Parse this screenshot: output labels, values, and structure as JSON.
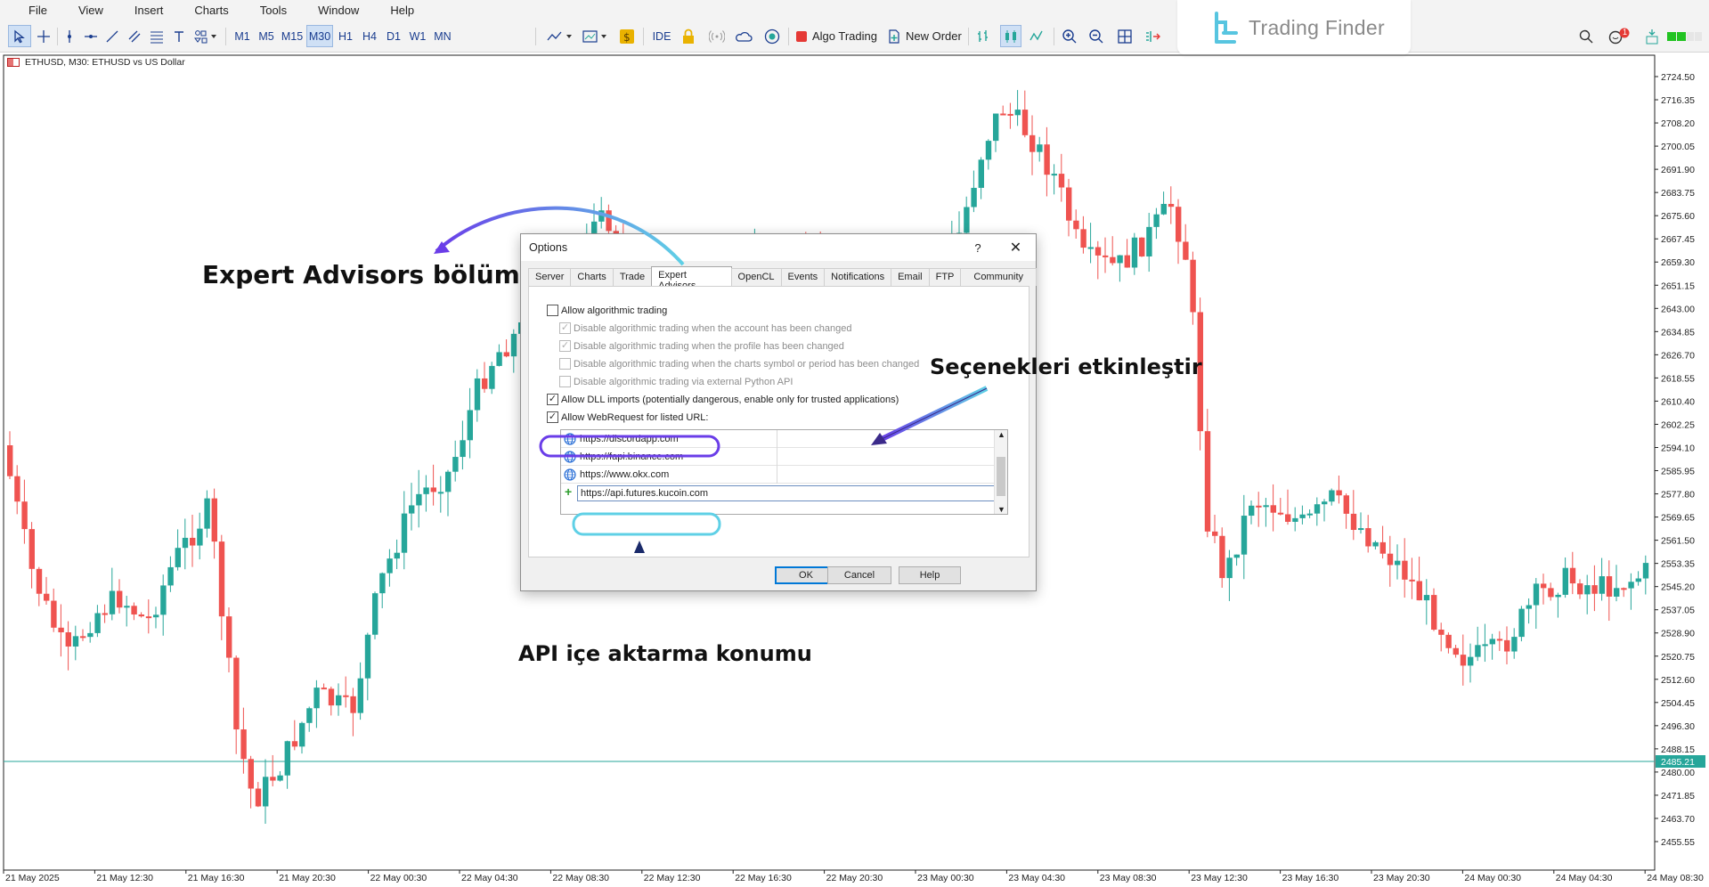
{
  "menu": [
    "File",
    "View",
    "Insert",
    "Charts",
    "Tools",
    "Window",
    "Help"
  ],
  "toolbar": {
    "timeframes": [
      "M1",
      "M5",
      "M15",
      "M30",
      "H1",
      "H4",
      "D1",
      "W1",
      "MN"
    ],
    "selected_timeframe": "M30",
    "ide_label": "IDE",
    "algo_label": "Algo Trading",
    "new_order_label": "New Order",
    "alert_count": "1"
  },
  "brand": {
    "name": "Trading Finder"
  },
  "chart": {
    "title": "ETHUSD, M30:  ETHUSD vs US Dollar",
    "price_labels": [
      "2724.50",
      "2716.35",
      "2708.20",
      "2700.05",
      "2691.90",
      "2683.75",
      "2675.60",
      "2667.45",
      "2659.30",
      "2651.15",
      "2643.00",
      "2634.85",
      "2626.70",
      "2618.55",
      "2610.40",
      "2602.25",
      "2594.10",
      "2585.95",
      "2577.80",
      "2569.65",
      "2561.50",
      "2553.35",
      "2545.20",
      "2537.05",
      "2528.90",
      "2520.75",
      "2512.60",
      "2504.45",
      "2496.30",
      "2488.15",
      "2480.00",
      "2471.85",
      "2463.70",
      "2455.55"
    ],
    "current_price": "2485.21",
    "time_labels": [
      "21 May 2025",
      "21 May 12:30",
      "21 May 16:30",
      "21 May 20:30",
      "22 May 00:30",
      "22 May 04:30",
      "22 May 08:30",
      "22 May 12:30",
      "22 May 16:30",
      "22 May 20:30",
      "23 May 00:30",
      "23 May 04:30",
      "23 May 08:30",
      "23 May 12:30",
      "23 May 16:30",
      "23 May 20:30",
      "24 May 00:30",
      "24 May 04:30",
      "24 May 08:30"
    ],
    "colors": {
      "bull": "#26a69a",
      "bear": "#ef5350",
      "price_line": "#26a69a"
    }
  },
  "dialog": {
    "title": "Options",
    "help_glyph": "?",
    "close_glyph": "✕",
    "tabs": [
      "Server",
      "Charts",
      "Trade",
      "Expert Advisors",
      "OpenCL",
      "Events",
      "Notifications",
      "Email",
      "FTP",
      "Community"
    ],
    "active_tab": "Expert Advisors",
    "options": [
      {
        "label": "Allow algorithmic trading",
        "checked": false,
        "disabled": false
      },
      {
        "label": "Disable algorithmic trading when the account has been changed",
        "checked": true,
        "disabled": true
      },
      {
        "label": "Disable algorithmic trading when the profile has been changed",
        "checked": true,
        "disabled": true
      },
      {
        "label": "Disable algorithmic trading when the charts symbol or period has been changed",
        "checked": false,
        "disabled": true
      },
      {
        "label": "Disable algorithmic trading via external Python API",
        "checked": false,
        "disabled": true
      },
      {
        "label": "Allow DLL imports (potentially dangerous, enable only for trusted applications)",
        "checked": true,
        "disabled": false
      },
      {
        "label": "Allow WebRequest for listed URL:",
        "checked": true,
        "disabled": false
      }
    ],
    "urls": [
      "https://discordapp.com",
      "https://fapi.binance.com",
      "https://www.okx.com"
    ],
    "new_url_value": "https://api.futures.kucoin.com",
    "add_glyph": "+",
    "buttons": {
      "ok": "OK",
      "cancel": "Cancel",
      "help": "Help"
    }
  },
  "annotations": {
    "expert_advisors": "Expert Advisors bölüm",
    "enable_options": "Seçenekleri etkinleştir",
    "api_import": "API içe aktarma konumu"
  }
}
